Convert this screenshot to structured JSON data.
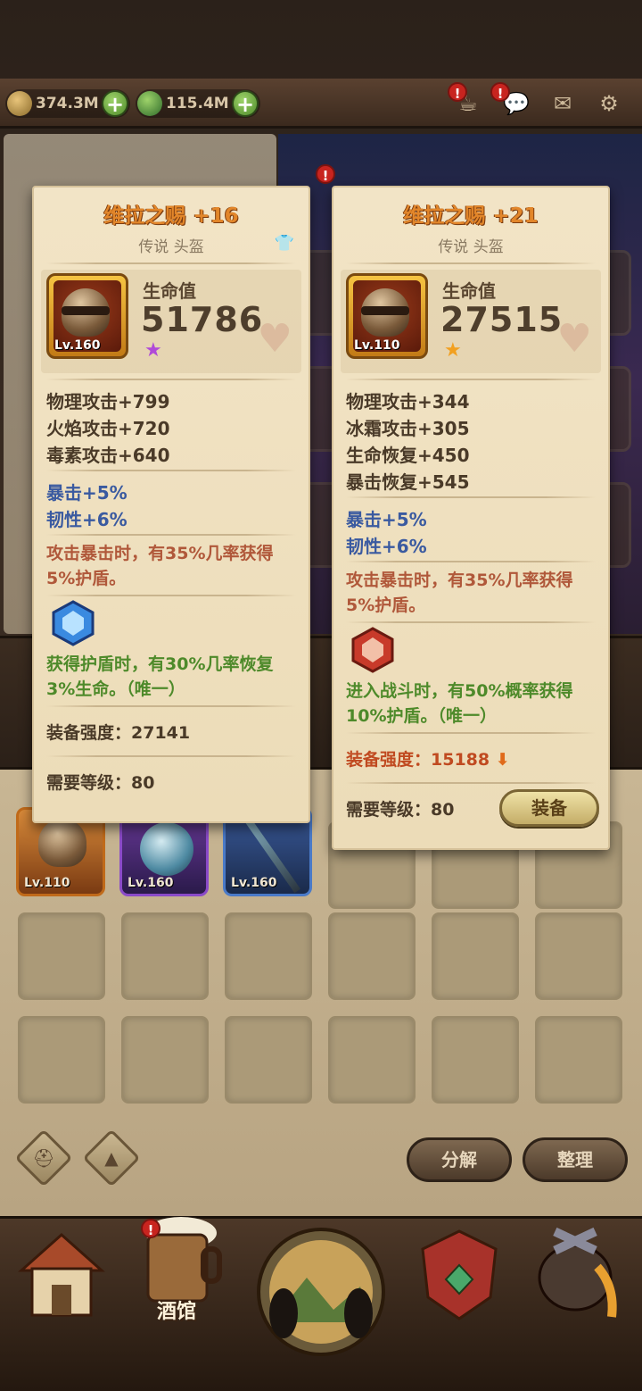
{
  "top_bar": {
    "gold": "374.3M",
    "gems": "115.4M",
    "alerts": [
      "!",
      "!"
    ]
  },
  "left_panel_alert": "!",
  "tavern_alert": "!",
  "inventory": {
    "items": [
      {
        "level": "Lv.110",
        "frame": "orange"
      },
      {
        "level": "Lv.160",
        "frame": "purple"
      },
      {
        "level": "Lv.160",
        "frame": "blue"
      }
    ],
    "decompose_label": "分解",
    "sort_label": "整理"
  },
  "bottom_nav": {
    "tavern_label": "酒馆"
  },
  "card_left": {
    "title": "维拉之赐 +16",
    "subtitle": "传说 头盔",
    "level": "Lv.160",
    "hp_label": "生命值",
    "hp_value": "51786",
    "star_color": "#b04ad8",
    "stats": [
      "物理攻击+799",
      "火焰攻击+720",
      "毒素攻击+640"
    ],
    "sub_stats": [
      "暴击+5%",
      "韧性+6%"
    ],
    "effect_1": "攻击暴击时，有35%几率获得5%护盾。",
    "unique_effect": "获得护盾时，有30%几率恢复3%生命。（唯一）",
    "strength": "装备强度：27141",
    "required_level": "需要等级：80"
  },
  "card_right": {
    "title": "维拉之赐 +21",
    "subtitle": "传说 头盔",
    "level": "Lv.110",
    "hp_label": "生命值",
    "hp_value": "27515",
    "star_color": "#f2a020",
    "stats": [
      "物理攻击+344",
      "冰霜攻击+305",
      "生命恢复+450",
      "暴击恢复+545"
    ],
    "sub_stats": [
      "暴击+5%",
      "韧性+6%"
    ],
    "effect_1": "攻击暴击时，有35%几率获得5%护盾。",
    "unique_effect": "进入战斗时，有50%概率获得10%护盾。（唯一）",
    "strength": "装备强度：15188",
    "required_level": "需要等级：80",
    "equip_label": "装备"
  },
  "colors": {
    "title_orange": "#e2862a",
    "blue_stat": "#3a5aa0",
    "red_effect": "#b0583a",
    "green_effect": "#4e8a2a"
  }
}
